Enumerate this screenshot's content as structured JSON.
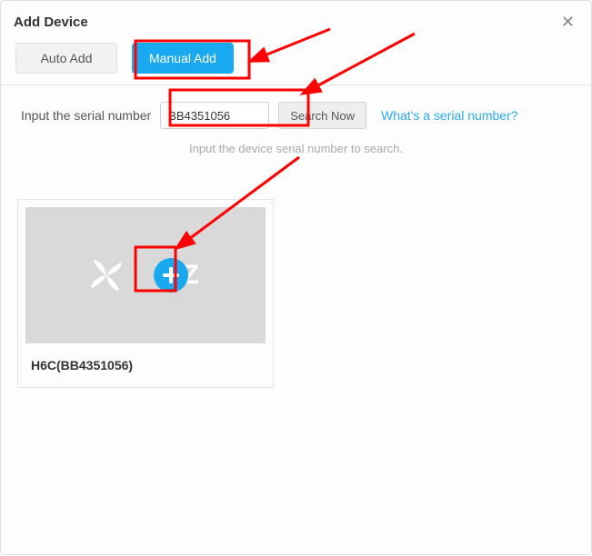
{
  "dialog": {
    "title": "Add Device"
  },
  "tabs": {
    "auto": "Auto Add",
    "manual": "Manual Add"
  },
  "serial": {
    "label": "Input the serial number",
    "value": "BB4351056",
    "searchLabel": "Search Now",
    "helpLink": "What's a serial number?",
    "hint": "Input the device serial number to search."
  },
  "device": {
    "name": "H6C(BB4351056)",
    "brandText": "VIZ"
  },
  "colors": {
    "accent": "#18a9f1",
    "highlight": "#ff0000"
  }
}
